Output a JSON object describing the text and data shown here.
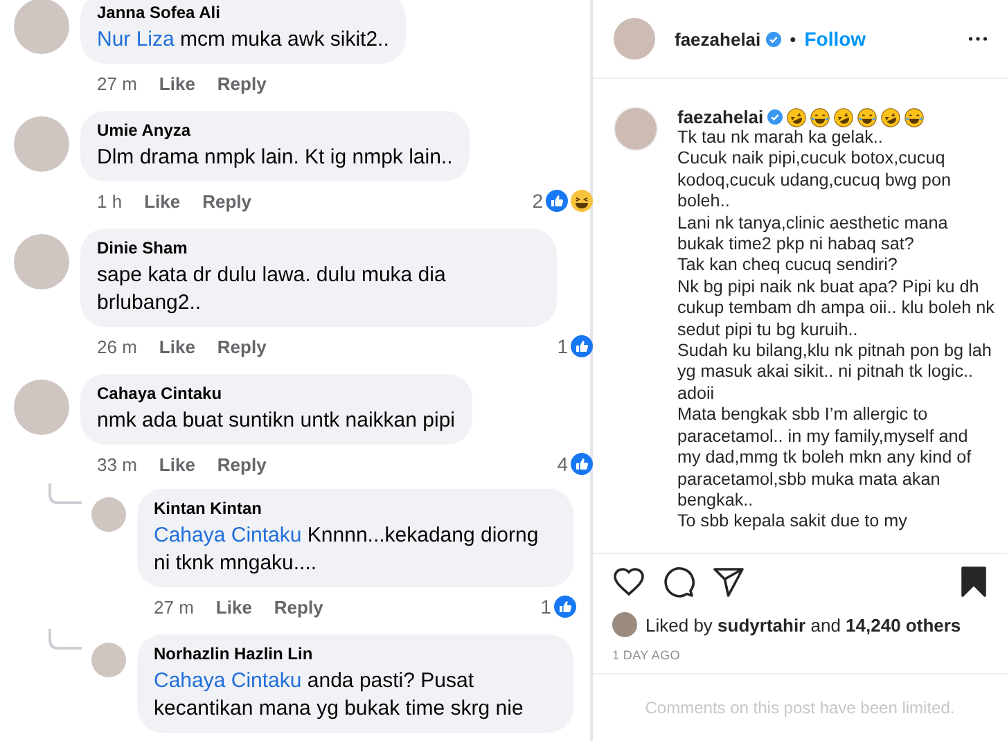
{
  "comments": [
    {
      "author": "Janna Sofea Ali",
      "mention": "Nur Liza",
      "text": "mcm muka awk sikit2..",
      "time": "27 m",
      "like": "Like",
      "reply": "Reply"
    },
    {
      "author": "Umie Anyza",
      "text": "Dlm drama nmpk lain.  Kt ig nmpk lain..",
      "time": "1 h",
      "like": "Like",
      "reply": "Reply",
      "reaction_count": "2",
      "reactions": [
        {
          "kind": "like"
        },
        {
          "kind": "haha"
        }
      ]
    },
    {
      "author": "Dinie Sham",
      "text": "sape kata dr dulu lawa. dulu muka dia brlubang2..",
      "time": "26 m",
      "like": "Like",
      "reply": "Reply",
      "reaction_count": "1",
      "reactions": [
        {
          "kind": "like"
        }
      ]
    },
    {
      "author": "Cahaya Cintaku",
      "text": "nmk ada buat suntikn untk naikkan pipi",
      "time": "33 m",
      "like": "Like",
      "reply": "Reply",
      "reaction_count": "4",
      "reactions": [
        {
          "kind": "like"
        }
      ],
      "replies": [
        {
          "author": "Kintan Kintan",
          "mention": "Cahaya Cintaku",
          "text": "Knnnn...kekadang diorng ni tknk mngaku....",
          "time": "27 m",
          "like": "Like",
          "reply": "Reply",
          "reaction_count": "1",
          "reactions": [
            {
              "kind": "like"
            }
          ]
        },
        {
          "author": "Norhazlin Hazlin Lin",
          "mention": "Cahaya Cintaku",
          "text": "anda pasti?  Pusat kecantikan mana yg bukak time skrg nie"
        }
      ]
    }
  ],
  "post": {
    "header_username": "faezahelai",
    "header_verified": true,
    "separator": "•",
    "follow": "Follow",
    "caption_username": "faezahelai",
    "caption_verified": true,
    "caption_emojis": [
      {
        "kind": "rofl"
      },
      {
        "kind": "joy"
      },
      {
        "kind": "rofl"
      },
      {
        "kind": "joy"
      },
      {
        "kind": "rofl"
      },
      {
        "kind": "joy"
      }
    ],
    "caption": [
      "Tk tau nk marah ka gelak..",
      "Cucuk naik pipi,cucuk botox,cucuq kodoq,cucuk udang,cucuq bwg pon boleh..",
      "Lani nk tanya,clinic aesthetic mana bukak time2 pkp ni habaq sat?",
      "Tak kan cheq cucuq sendiri?",
      "Nk bg pipi naik nk buat apa? Pipi ku dh cukup tembam dh ampa oii.. klu boleh nk sedut pipi tu bg kuruih..",
      "Sudah ku bilang,klu nk pitnah pon bg lah yg masuk akai sikit.. ni pitnah tk logic.. adoii",
      "Mata bengkak sbb I’m allergic to paracetamol.. in my family,myself and my dad,mmg tk boleh mkn any kind of paracetamol,sbb muka mata akan bengkak..",
      "To sbb kepala sakit due to my"
    ],
    "saved": true,
    "liked_by_prefix": "Liked by",
    "liked_by_user": "sudyrtahir",
    "liked_by_and": "and",
    "liked_by_count": "14,240 others",
    "date": "1 DAY AGO",
    "comments_notice": "Comments on this post have been limited."
  }
}
